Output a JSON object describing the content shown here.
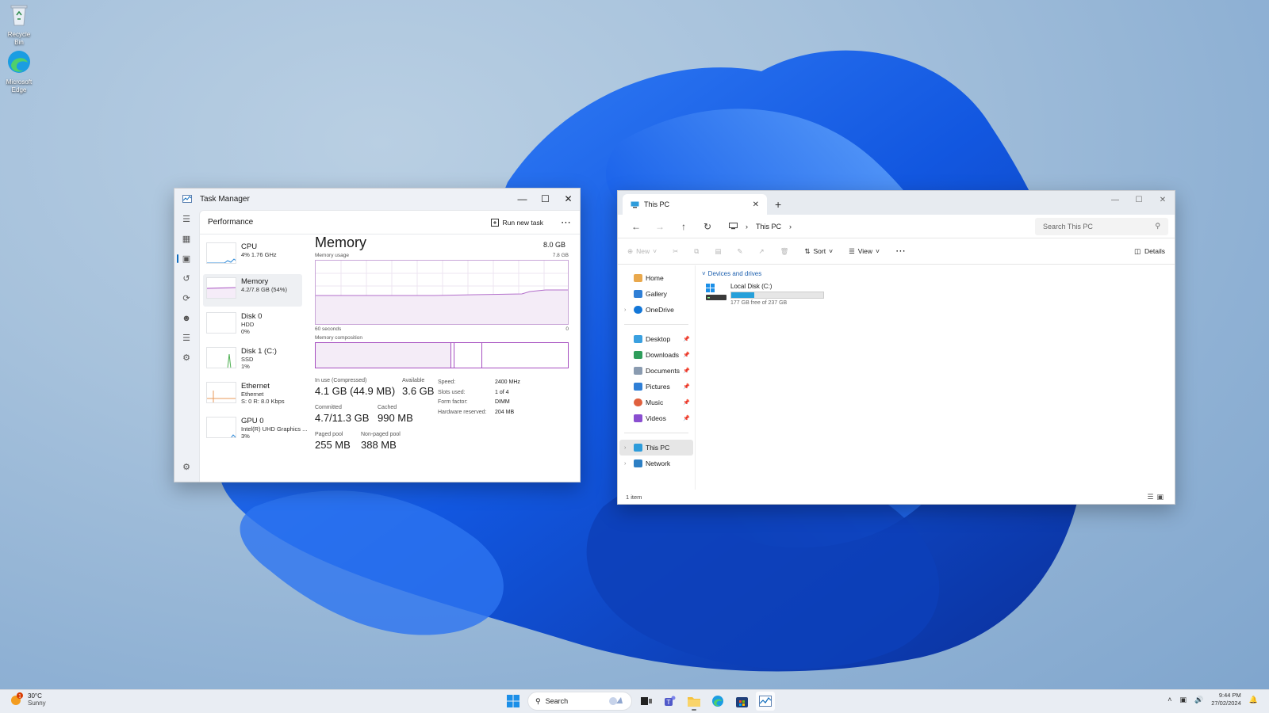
{
  "desktop": {
    "icons": [
      {
        "label": "Recycle Bin",
        "icon": "recycle-bin-icon"
      },
      {
        "label": "Microsoft Edge",
        "icon": "edge-icon"
      }
    ]
  },
  "task_manager": {
    "title": "Task Manager",
    "header": {
      "title": "Performance",
      "run_new_task": "Run new task"
    },
    "perf_items": [
      {
        "name": "CPU",
        "sub1": "4%  1.76 GHz",
        "sub2": ""
      },
      {
        "name": "Memory",
        "sub1": "4.2/7.8 GB (54%)",
        "sub2": ""
      },
      {
        "name": "Disk 0",
        "sub1": "HDD",
        "sub2": "0%"
      },
      {
        "name": "Disk 1 (C:)",
        "sub1": "SSD",
        "sub2": "1%"
      },
      {
        "name": "Ethernet",
        "sub1": "Ethernet",
        "sub2": "S: 0  R: 8.0 Kbps"
      },
      {
        "name": "GPU 0",
        "sub1": "Intel(R) UHD Graphics ...",
        "sub2": "3%"
      }
    ],
    "memory": {
      "title": "Memory",
      "total": "8.0 GB",
      "usage_label": "Memory usage",
      "usage_max": "7.8 GB",
      "time_left": "60 seconds",
      "time_right": "0",
      "composition_label": "Memory composition",
      "stats": {
        "in_use_label": "In use (Compressed)",
        "in_use": "4.1 GB (44.9 MB)",
        "available_label": "Available",
        "available": "3.6 GB",
        "committed_label": "Committed",
        "committed": "4.7/11.3 GB",
        "cached_label": "Cached",
        "cached": "990 MB",
        "paged_label": "Paged pool",
        "paged": "255 MB",
        "nonpaged_label": "Non-paged pool",
        "nonpaged": "388 MB"
      },
      "details": [
        {
          "k": "Speed:",
          "v": "2400 MHz"
        },
        {
          "k": "Slots used:",
          "v": "1 of 4"
        },
        {
          "k": "Form factor:",
          "v": "DIMM"
        },
        {
          "k": "Hardware reserved:",
          "v": "204 MB"
        }
      ]
    }
  },
  "explorer": {
    "tab_title": "This PC",
    "breadcrumb": "This PC",
    "search_placeholder": "Search This PC",
    "commands": {
      "new": "New",
      "sort": "Sort",
      "view": "View",
      "details": "Details"
    },
    "nav": {
      "home": "Home",
      "gallery": "Gallery",
      "onedrive": "OneDrive",
      "desktop": "Desktop",
      "downloads": "Downloads",
      "documents": "Documents",
      "pictures": "Pictures",
      "music": "Music",
      "videos": "Videos",
      "this_pc": "This PC",
      "network": "Network"
    },
    "group_label": "Devices and drives",
    "drive": {
      "name": "Local Disk (C:)",
      "free": "177 GB free of 237 GB",
      "used_fraction": 0.253
    },
    "status": "1 item"
  },
  "taskbar": {
    "weather": {
      "temp": "30°C",
      "condition": "Sunny",
      "badge": "1"
    },
    "search_label": "Search",
    "time": "9:44 PM",
    "date": "27/02/2024"
  },
  "colors": {
    "accent": "#0f6cbd",
    "memory": "#a64fc0",
    "drive_fill": "#26a0da"
  }
}
